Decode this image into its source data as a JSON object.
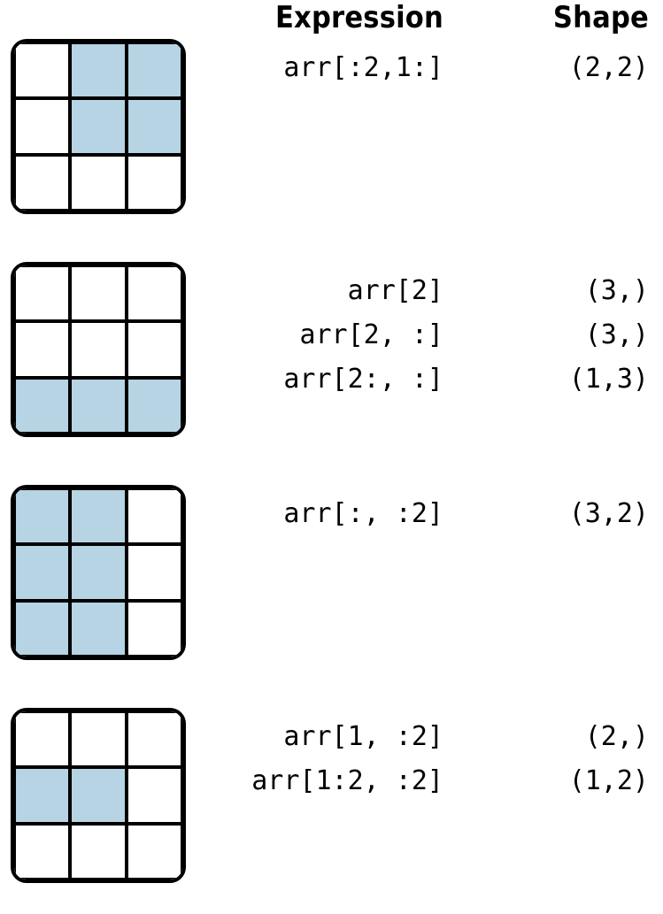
{
  "headers": {
    "expression": "Expression",
    "shape": "Shape"
  },
  "chart_data": {
    "type": "table",
    "grid_size": [
      3,
      3
    ],
    "highlight_color": "#b6d4e3",
    "examples": [
      {
        "highlighted_cells": [
          [
            0,
            1
          ],
          [
            0,
            2
          ],
          [
            1,
            1
          ],
          [
            1,
            2
          ]
        ],
        "rows": [
          {
            "expression": "arr[:2,1:]",
            "shape": "(2,2)"
          }
        ]
      },
      {
        "highlighted_cells": [
          [
            2,
            0
          ],
          [
            2,
            1
          ],
          [
            2,
            2
          ]
        ],
        "rows": [
          {
            "expression": "arr[2]",
            "shape": "(3,)"
          },
          {
            "expression": "arr[2, :]",
            "shape": "(3,)"
          },
          {
            "expression": "arr[2:, :]",
            "shape": "(1,3)"
          }
        ]
      },
      {
        "highlighted_cells": [
          [
            0,
            0
          ],
          [
            0,
            1
          ],
          [
            1,
            0
          ],
          [
            1,
            1
          ],
          [
            2,
            0
          ],
          [
            2,
            1
          ]
        ],
        "rows": [
          {
            "expression": "arr[:, :2]",
            "shape": "(3,2)"
          }
        ]
      },
      {
        "highlighted_cells": [
          [
            1,
            0
          ],
          [
            1,
            1
          ]
        ],
        "rows": [
          {
            "expression": "arr[1, :2]",
            "shape": "(2,)"
          },
          {
            "expression": "arr[1:2, :2]",
            "shape": "(1,2)"
          }
        ]
      }
    ]
  }
}
